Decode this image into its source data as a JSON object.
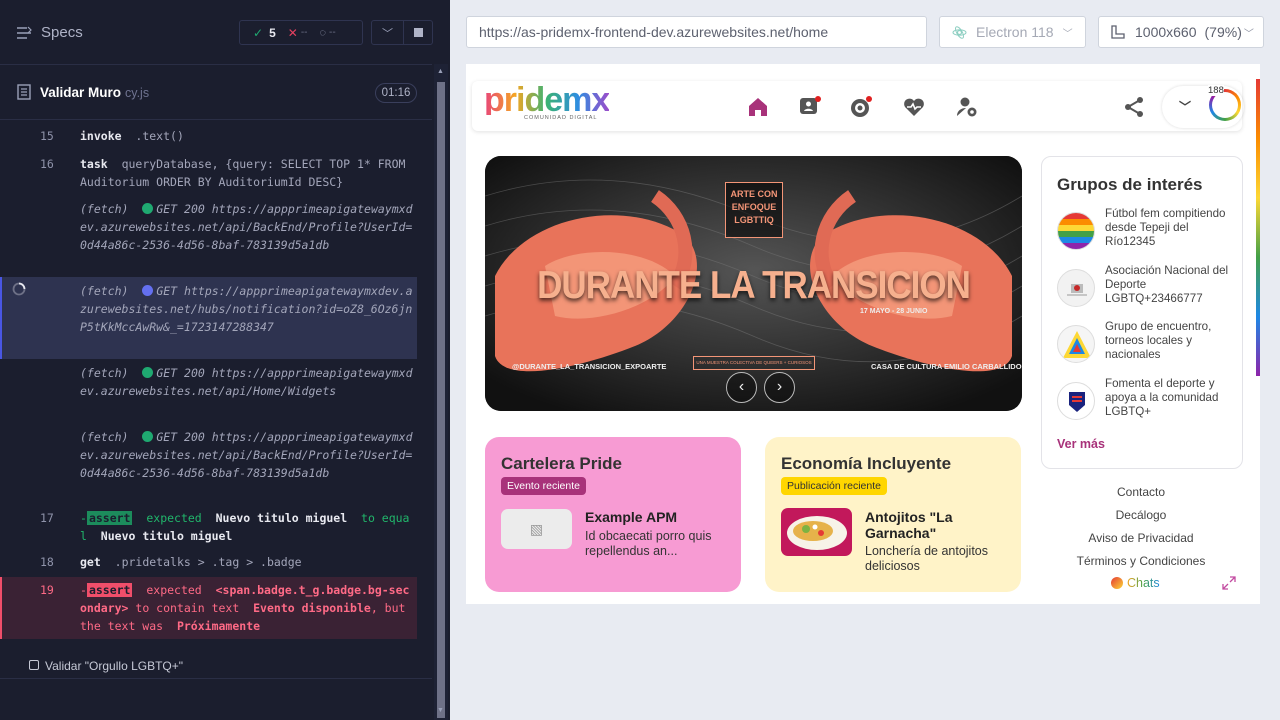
{
  "left": {
    "specs_label": "Specs",
    "stats": {
      "passed": "5",
      "failed": "--",
      "pending": "--"
    },
    "run": {
      "name": "Validar Muro",
      "ext": "cy.js",
      "time": "01:16"
    },
    "commands": [
      {
        "num": "15",
        "name": "invoke",
        "msg": ".text()"
      },
      {
        "num": "16",
        "name": "task",
        "msg": "queryDatabase, {query: SELECT TOP 1* FROM Auditorium ORDER BY AuditoriumId DESC}"
      },
      {
        "num": "",
        "name": "(fetch)",
        "method": "GET 200",
        "url": "https://appprimeapigatewaymxdev.azurewebsites.net/api/BackEnd/Profile?UserId=0d44a86c-2536-4d56-8baf-783139d5a1db"
      },
      {
        "num": "",
        "name": "(fetch)",
        "method": "GET",
        "url": "https://appprimeapigatewaymxdev.azurewebsites.net/hubs/notification?id=oZ8_6Oz6jnP5tKkMccAwRw&_=1723147288347"
      },
      {
        "num": "",
        "name": "(fetch)",
        "method": "GET 200",
        "url": "https://appprimeapigatewaymxdev.azurewebsites.net/api/Home/Widgets"
      },
      {
        "num": "",
        "name": "(fetch)",
        "method": "GET 200",
        "url": "https://appprimeapigatewaymxdev.azurewebsites.net/api/BackEnd/Profile?UserId=0d44a86c-2536-4d56-8baf-783139d5a1db"
      },
      {
        "num": "17",
        "name": "assert",
        "msg_a": "expected",
        "msg_b": "Nuevo titulo miguel",
        "msg_c": "to equal",
        "msg_d": "Nuevo titulo miguel"
      },
      {
        "num": "18",
        "name": "get",
        "msg": ".pridetalks > .tag > .badge"
      },
      {
        "num": "19",
        "name": "assert",
        "msg_a": "expected",
        "msg_b": "<span.badge.t_g.badge.bg-secondary>",
        "msg_c": "to contain text",
        "msg_d": "Evento disponible",
        "msg_e": ", but the text was",
        "msg_f": "Próximamente"
      }
    ],
    "next_test": "Validar \"Orgullo LGBTQ+\""
  },
  "browser": {
    "url": "https://as-pridemx-frontend-dev.azurewebsites.net/home",
    "engine": "Electron 118",
    "viewport": "1000x660",
    "zoom": "(79%)"
  },
  "app": {
    "logo_text": "pridemx",
    "logo_sub": "COMUNIDAD DIGITAL",
    "notif_count": "188",
    "hero": {
      "badge": "ARTE CON ENFOQUE LGBTTIQ",
      "title": "DURANTE LA TRANSICION",
      "dates": "17 MAYO - 28 JUNIO",
      "handle": "@DURANTE_LA_TRANSICION_EXPOARTE",
      "mid": "UNA MUESTRA COLECTIVA DE QUEERS + CURIOSOS",
      "venue": "CASA DE CULTURA EMILIO CARBALLIDO"
    },
    "cards": [
      {
        "title": "Cartelera Pride",
        "tag": "Evento reciente",
        "item_title": "Example APM",
        "item_desc": "Id obcaecati porro quis repellendus an..."
      },
      {
        "title": "Economía Incluyente",
        "tag": "Publicación reciente",
        "item_title": "Antojitos \"La Garnacha\"",
        "item_desc": "Lonchería de antojitos deliciosos"
      }
    ],
    "groups": {
      "title": "Grupos de interés",
      "items": [
        "Fútbol fem compitiendo desde Tepeji del Río12345",
        "Asociación Nacional del Deporte LGBTQ+23466777",
        "Grupo de encuentro, torneos locales y nacionales",
        "Fomenta el deporte y apoya a la comunidad LGBTQ+"
      ],
      "more": "Ver más"
    },
    "footer": [
      "Contacto",
      "Decálogo",
      "Aviso de Privacidad",
      "Términos y Condiciones"
    ],
    "chats": "Chats"
  },
  "colors": {
    "accent": "#a8327a",
    "pink_card": "#f79bd3",
    "yellow_card": "#fff3c8"
  }
}
